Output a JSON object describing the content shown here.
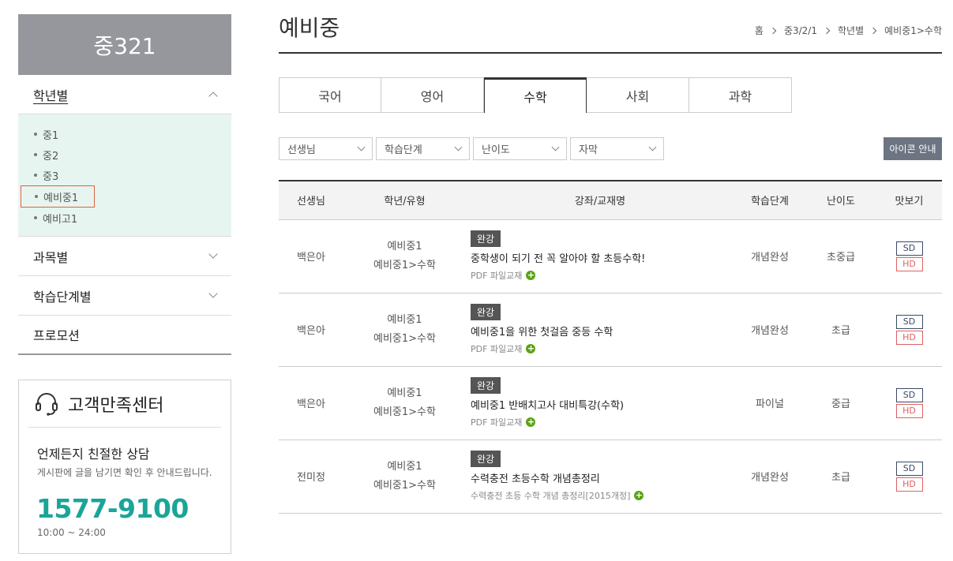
{
  "sidebar": {
    "header": "중321",
    "menus": [
      {
        "label": "학년별",
        "expanded": true
      },
      {
        "label": "과목별",
        "expanded": false
      },
      {
        "label": "학습단계별",
        "expanded": false
      },
      {
        "label": "프로모션"
      }
    ],
    "sub_items": [
      "중1",
      "중2",
      "중3",
      "예비중1",
      "예비고1"
    ],
    "selected_sub": "예비중1"
  },
  "customer_center": {
    "title": "고객만족센터",
    "lead": "언제든지 친절한 상담",
    "desc": "게시판에 글을 남기면 확인 후 안내드립니다.",
    "phone": "1577-9100",
    "hours": "10:00 ~ 24:00"
  },
  "page": {
    "title": "예비중",
    "breadcrumb": [
      "홈",
      "중3/2/1",
      "학년별",
      "예비중1>수학"
    ]
  },
  "tabs": [
    "국어",
    "영어",
    "수학",
    "사회",
    "과학"
  ],
  "active_tab": "수학",
  "filters": [
    "선생님",
    "학습단계",
    "난이도",
    "자막"
  ],
  "icon_guide_label": "아이콘 안내",
  "table": {
    "headers": [
      "선생님",
      "학년/유형",
      "강좌/교재명",
      "학습단계",
      "난이도",
      "맛보기"
    ],
    "rows": [
      {
        "teacher": "백은아",
        "grade": "예비중1",
        "type": "예비중1>수학",
        "badge": "완강",
        "title": "중학생이 되기 전 꼭 알아야 할 초등수학!",
        "sub": "PDF 파일교재",
        "stage": "개념완성",
        "level": "초중급",
        "sd": "SD",
        "hd": "HD"
      },
      {
        "teacher": "백은아",
        "grade": "예비중1",
        "type": "예비중1>수학",
        "badge": "완강",
        "title": "예비중1을 위한 첫걸음 중등 수학",
        "sub": "PDF 파일교재",
        "stage": "개념완성",
        "level": "초급",
        "sd": "SD",
        "hd": "HD"
      },
      {
        "teacher": "백은아",
        "grade": "예비중1",
        "type": "예비중1>수학",
        "badge": "완강",
        "title": "예비중1 반배치고사 대비특강(수학)",
        "sub": "PDF 파일교재",
        "stage": "파이널",
        "level": "중급",
        "sd": "SD",
        "hd": "HD"
      },
      {
        "teacher": "전미정",
        "grade": "예비중1",
        "type": "예비중1>수학",
        "badge": "완강",
        "title": "수력충전 초등수학 개념총정리",
        "sub": "수력충전 초등 수학 개념 총정리[2015개정]",
        "stage": "개념완성",
        "level": "초급",
        "sd": "SD",
        "hd": "HD"
      }
    ]
  },
  "colors": {
    "accent_teal": "#1aa598",
    "sidebar_header": "#96979d",
    "submenu_bg": "#e7f5f0",
    "selected_border": "#d9643e",
    "plus_green": "#5ba317"
  }
}
